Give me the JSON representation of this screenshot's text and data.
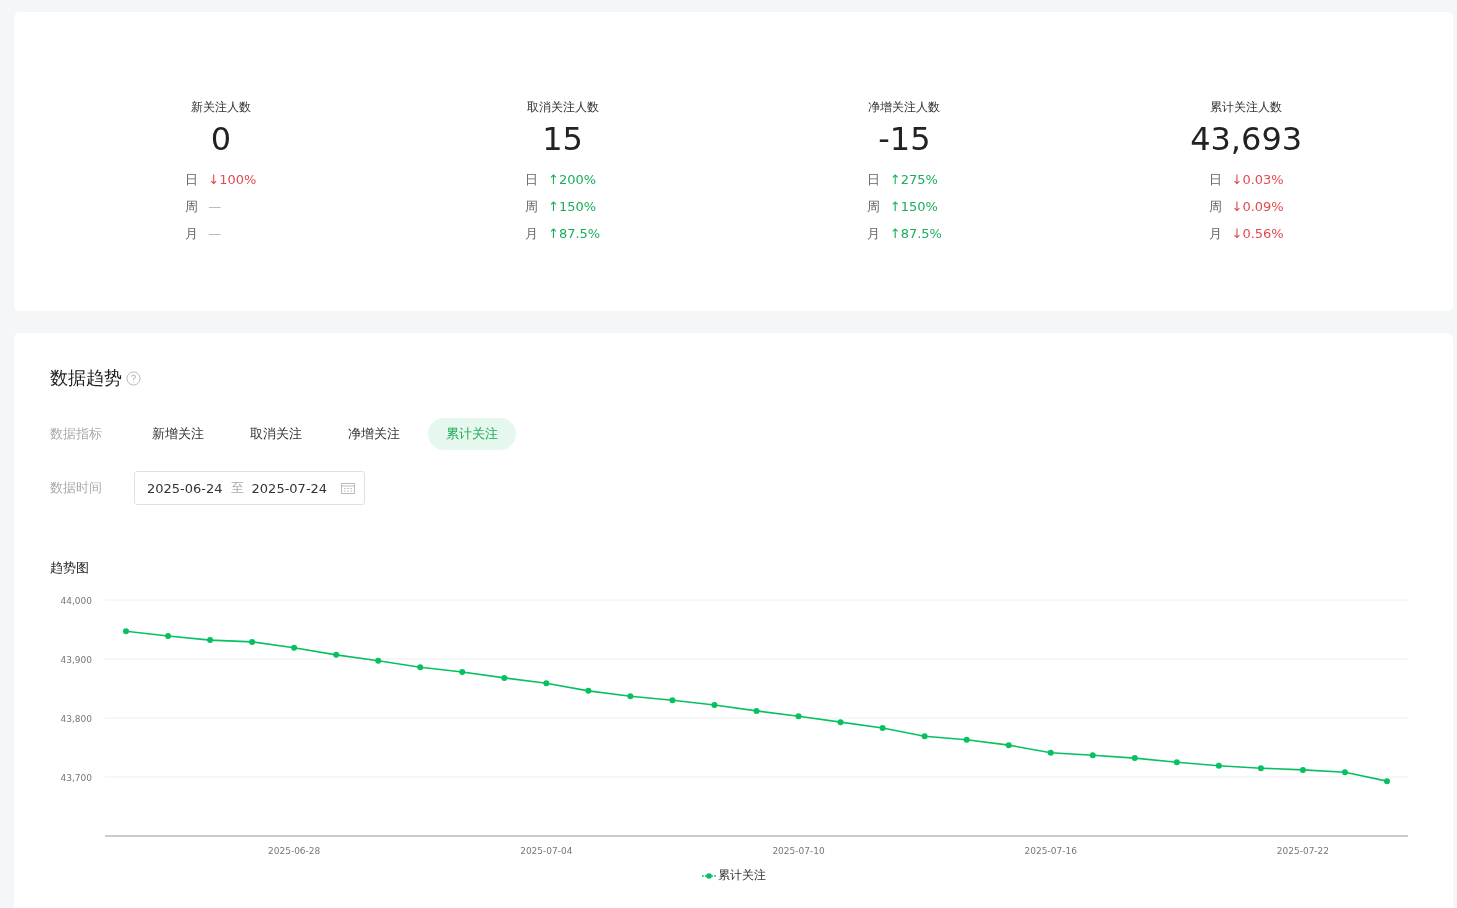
{
  "stats": [
    {
      "label": "新关注人数",
      "value": "0",
      "changes": [
        {
          "period": "日",
          "text": "↓100%",
          "color": "#e5484d"
        },
        {
          "period": "周",
          "text": "—",
          "color": "#b4b4b4"
        },
        {
          "period": "月",
          "text": "—",
          "color": "#b4b4b4"
        }
      ]
    },
    {
      "label": "取消关注人数",
      "value": "15",
      "changes": [
        {
          "period": "日",
          "text": "↑200%",
          "color": "#1aad5b"
        },
        {
          "period": "周",
          "text": "↑150%",
          "color": "#1aad5b"
        },
        {
          "period": "月",
          "text": "↑87.5%",
          "color": "#1aad5b"
        }
      ]
    },
    {
      "label": "净增关注人数",
      "value": "-15",
      "changes": [
        {
          "period": "日",
          "text": "↑275%",
          "color": "#1aad5b"
        },
        {
          "period": "周",
          "text": "↑150%",
          "color": "#1aad5b"
        },
        {
          "period": "月",
          "text": "↑87.5%",
          "color": "#1aad5b"
        }
      ]
    },
    {
      "label": "累计关注人数",
      "value": "43,693",
      "changes": [
        {
          "period": "日",
          "text": "↓0.03%",
          "color": "#e5484d"
        },
        {
          "period": "周",
          "text": "↓0.09%",
          "color": "#e5484d"
        },
        {
          "period": "月",
          "text": "↓0.56%",
          "color": "#e5484d"
        }
      ]
    }
  ],
  "trend": {
    "title": "数据趋势",
    "metric_label": "数据指标",
    "metrics": [
      {
        "label": "新增关注",
        "selected": false
      },
      {
        "label": "取消关注",
        "selected": false
      },
      {
        "label": "净增关注",
        "selected": false
      },
      {
        "label": "累计关注",
        "selected": true
      }
    ],
    "date_label": "数据时间",
    "date_start": "2025-06-24",
    "date_separator": "至",
    "date_end": "2025-07-24",
    "chart_title": "趋势图",
    "chart_data": {
      "type": "line",
      "grid": true,
      "categories": [
        null,
        null,
        null,
        null,
        "2025-06-28",
        null,
        null,
        null,
        null,
        null,
        "2025-07-04",
        null,
        null,
        null,
        null,
        null,
        "2025-07-10",
        null,
        null,
        null,
        null,
        null,
        "2025-07-16",
        null,
        null,
        null,
        null,
        null,
        "2025-07-22",
        null,
        null
      ],
      "series": [
        {
          "name": "累计关注",
          "color": "#07c160",
          "marker": "circle",
          "values": [
            43947,
            43939,
            43932,
            43929,
            43919,
            43907,
            43897,
            43886,
            43878,
            43868,
            43859,
            43846,
            43837,
            43830,
            43822,
            43812,
            43803,
            43793,
            43783,
            43769,
            43763,
            43754,
            43741,
            43737,
            43732,
            43725,
            43719,
            43715,
            43712,
            43708,
            43693
          ]
        }
      ],
      "ylim": [
        43600,
        44000
      ],
      "yticks": [
        {
          "value": 43700,
          "label": "43,700"
        },
        {
          "value": 43800,
          "label": "43,800"
        },
        {
          "value": 43900,
          "label": "43,900"
        },
        {
          "value": 44000,
          "label": "44,000"
        }
      ]
    }
  }
}
